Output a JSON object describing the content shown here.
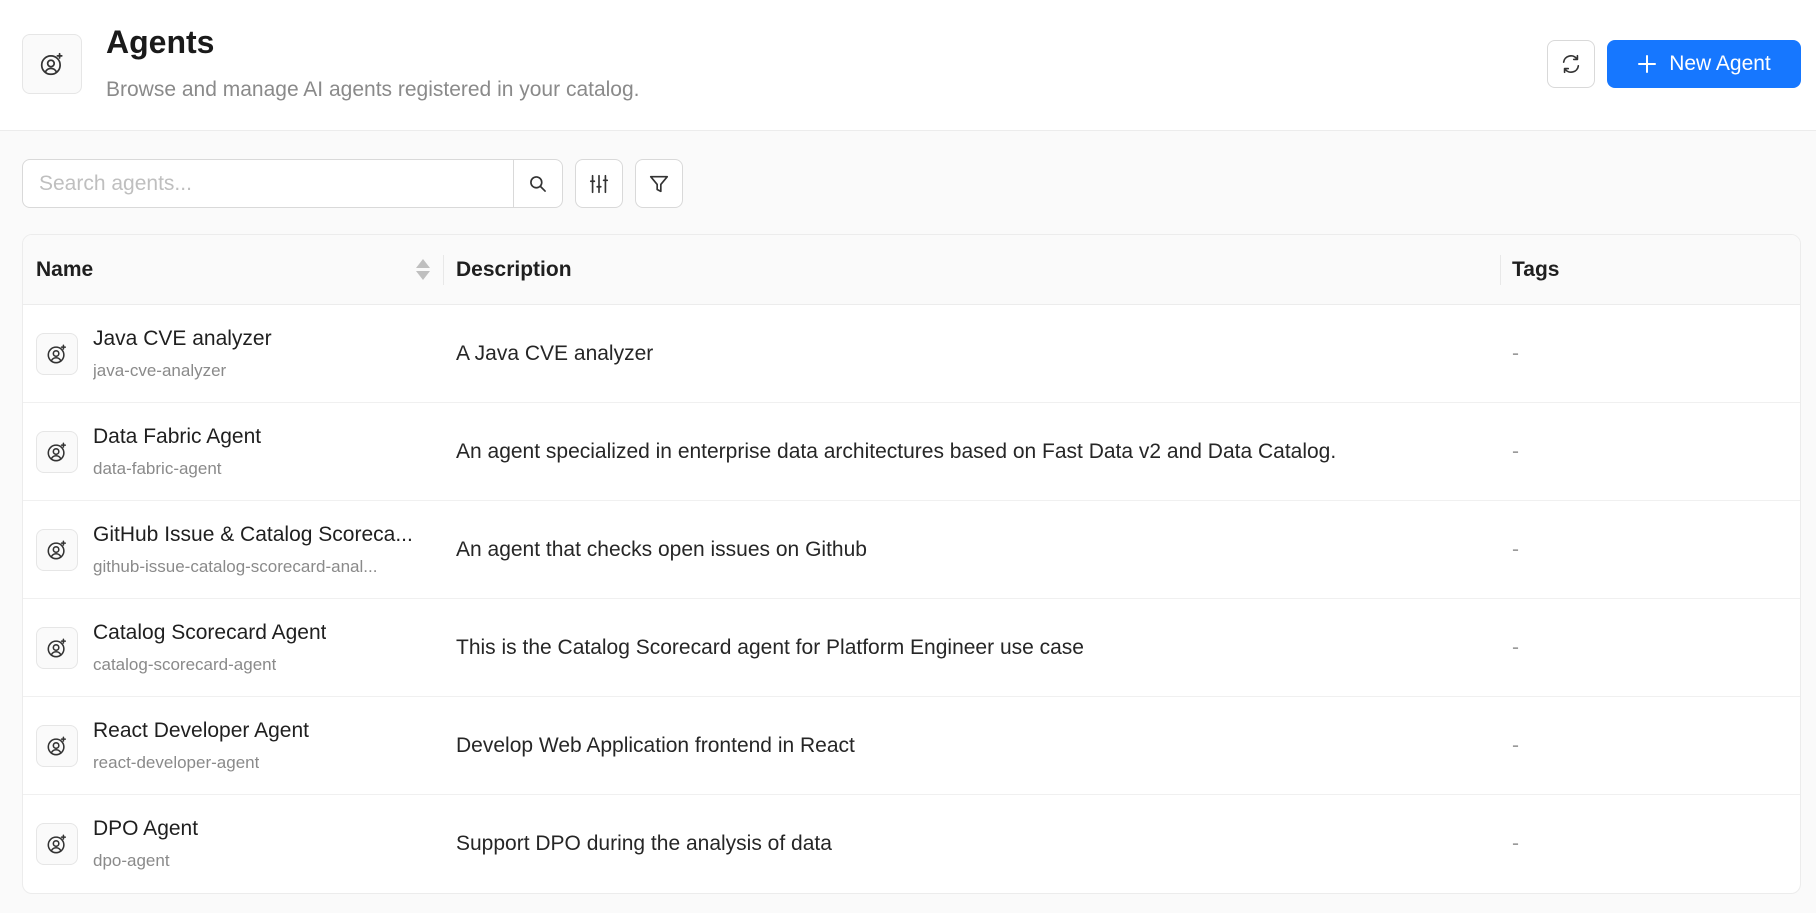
{
  "header": {
    "title": "Agents",
    "subtitle": "Browse and manage AI agents registered in your catalog.",
    "new_button_label": "New Agent",
    "icon": "agent-icon"
  },
  "toolbar": {
    "search_placeholder": "Search agents...",
    "search_value": ""
  },
  "table": {
    "columns": [
      "Name",
      "Description",
      "Tags"
    ],
    "rows": [
      {
        "name": "Java CVE analyzer",
        "slug": "java-cve-analyzer",
        "description": "A Java CVE analyzer",
        "tags": "-"
      },
      {
        "name": "Data Fabric Agent",
        "slug": "data-fabric-agent",
        "description": "An agent specialized in enterprise data architectures based on Fast Data v2 and Data Catalog.",
        "tags": "-"
      },
      {
        "name": "GitHub Issue & Catalog Scoreca...",
        "slug": "github-issue-catalog-scorecard-anal...",
        "description": "An agent that checks open issues on Github",
        "tags": "-"
      },
      {
        "name": "Catalog Scorecard Agent",
        "slug": "catalog-scorecard-agent",
        "description": "This is the Catalog Scorecard agent for Platform Engineer use case",
        "tags": "-"
      },
      {
        "name": "React Developer Agent",
        "slug": "react-developer-agent",
        "description": "Develop Web Application frontend in React",
        "tags": "-"
      },
      {
        "name": "DPO Agent",
        "slug": "dpo-agent",
        "description": "Support DPO during the analysis of data",
        "tags": "-"
      }
    ]
  },
  "colors": {
    "accent": "#1677ff",
    "border": "#d9d9d9",
    "muted_text": "#8a8a8a"
  }
}
